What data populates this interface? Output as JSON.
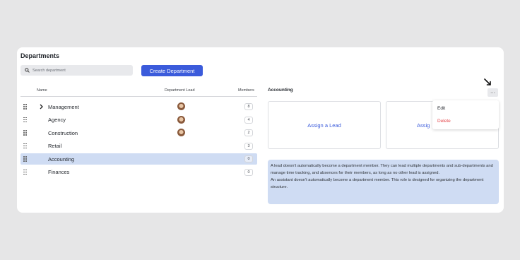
{
  "page": {
    "title": "Departments"
  },
  "search": {
    "placeholder": "Search department"
  },
  "create_button": {
    "label": "Create Department"
  },
  "table": {
    "headers": {
      "name": "Name",
      "lead": "Department Lead",
      "members": "Members"
    },
    "rows": [
      {
        "name": "Management",
        "has_lead": true,
        "members": "8",
        "expandable": true,
        "selected": false
      },
      {
        "name": "Agency",
        "has_lead": true,
        "members": "4",
        "expandable": false,
        "selected": false
      },
      {
        "name": "Construction",
        "has_lead": true,
        "members": "2",
        "expandable": false,
        "selected": false
      },
      {
        "name": "Retail",
        "has_lead": false,
        "members": "3",
        "expandable": false,
        "selected": false
      },
      {
        "name": "Accounting",
        "has_lead": false,
        "members": "0",
        "expandable": false,
        "selected": true
      },
      {
        "name": "Finances",
        "has_lead": false,
        "members": "0",
        "expandable": false,
        "selected": false
      }
    ]
  },
  "detail": {
    "title": "Accounting",
    "more_label": "···",
    "assign_lead_label": "Assign a Lead",
    "assign_assistant_label": "Assig",
    "info": [
      "A lead doesn't automatically become a department member. They can lead multiple departments and sub-departments and manage time tracking, and absences for their members, as long as no other lead is assigned.",
      "An assistant doesn't automatically become a department member. This role is designed for organizing the department structure."
    ]
  },
  "menu": {
    "edit_label": "Edit",
    "delete_label": "Delete"
  },
  "colors": {
    "accent": "#3b5bdb",
    "selected_row": "#cfdcf3",
    "delete": "#e5484d",
    "background": "#e6e6e7"
  }
}
